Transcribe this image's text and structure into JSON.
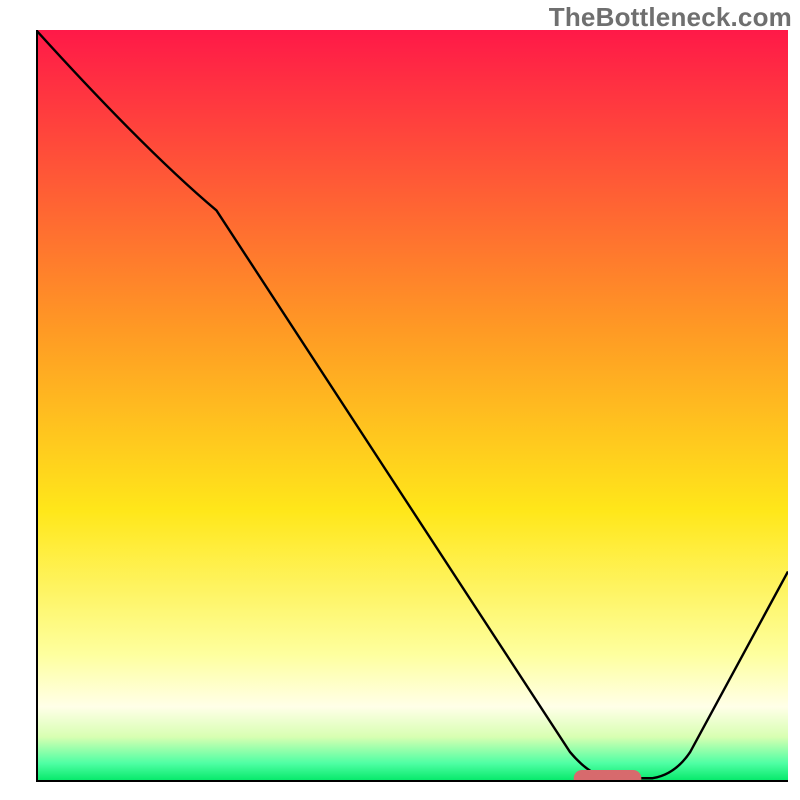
{
  "watermark": "TheBottleneck.com",
  "chart_data": {
    "type": "line",
    "title": "",
    "xlabel": "",
    "ylabel": "",
    "xlim": [
      0,
      100
    ],
    "ylim": [
      0,
      100
    ],
    "background_gradient": {
      "stops": [
        {
          "offset": 0.0,
          "color": "#ff1948"
        },
        {
          "offset": 0.4,
          "color": "#ff9a24"
        },
        {
          "offset": 0.64,
          "color": "#ffe71a"
        },
        {
          "offset": 0.83,
          "color": "#feff9e"
        },
        {
          "offset": 0.9,
          "color": "#ffffe8"
        },
        {
          "offset": 0.94,
          "color": "#d8ffb2"
        },
        {
          "offset": 0.975,
          "color": "#4fffa4"
        },
        {
          "offset": 1.0,
          "color": "#00e765"
        }
      ]
    },
    "curve": {
      "segments": [
        {
          "type": "M",
          "x": 0.0,
          "y": 100.0
        },
        {
          "type": "Q",
          "cx": 14.5,
          "cy": 84.0,
          "x": 24.0,
          "y": 76.0
        },
        {
          "type": "L",
          "x": 71.0,
          "y": 4.0
        },
        {
          "type": "Q",
          "cx": 73.5,
          "cy": 1.0,
          "x": 76.0,
          "y": 0.5
        },
        {
          "type": "L",
          "x": 82.0,
          "y": 0.5
        },
        {
          "type": "Q",
          "cx": 85.0,
          "cy": 1.0,
          "x": 87.0,
          "y": 4.0
        },
        {
          "type": "L",
          "x": 100.0,
          "y": 28.0
        }
      ],
      "stroke": "#000000",
      "stroke_width": 2.4
    },
    "marker": {
      "x": 76.0,
      "y": 0.5,
      "width": 9.0,
      "height": 2.2,
      "rx": 1.1,
      "fill": "#d76a6d"
    },
    "axes": {
      "stroke": "#000000",
      "stroke_width": 4.0
    }
  }
}
